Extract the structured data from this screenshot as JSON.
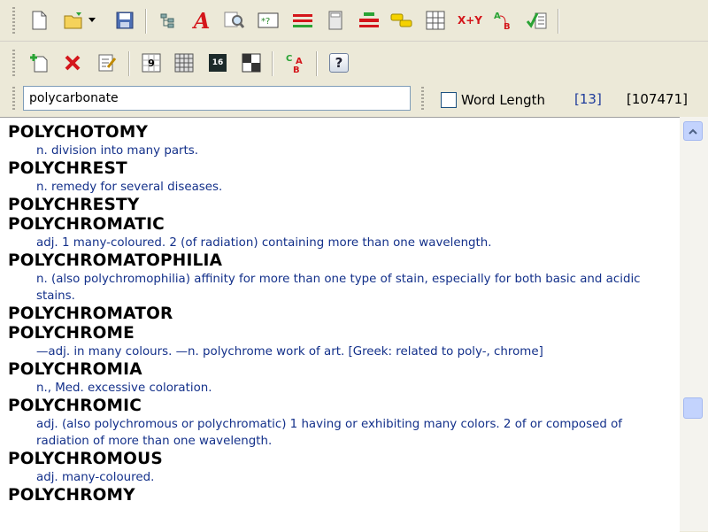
{
  "toolbar_top": {
    "buttons": [
      {
        "name": "new-document-icon"
      },
      {
        "name": "open-folder-icon"
      },
      {
        "name": "save-icon"
      },
      {
        "name": "tree-view-icon"
      },
      {
        "name": "anagram-icon"
      },
      {
        "name": "find-icon"
      },
      {
        "name": "wildcard-icon"
      },
      {
        "name": "rhyme-icon"
      },
      {
        "name": "calculator-icon"
      },
      {
        "name": "word-split-icon"
      },
      {
        "name": "tag-icon"
      },
      {
        "name": "grid-icon"
      },
      {
        "name": "cipher-icon"
      },
      {
        "name": "abc-icon"
      },
      {
        "name": "spell-check-icon"
      }
    ],
    "cipher_text": "X+Y",
    "abc_text_a": "A",
    "abc_text_b": "B"
  },
  "toolbar_bottom": {
    "buttons": [
      {
        "name": "add-word-icon"
      },
      {
        "name": "delete-icon"
      },
      {
        "name": "edit-icon"
      },
      {
        "name": "sudoku-icon"
      },
      {
        "name": "board-icon"
      },
      {
        "name": "number-grid-icon"
      },
      {
        "name": "crossword-icon"
      },
      {
        "name": "letter-swap-icon"
      },
      {
        "name": "help-icon"
      }
    ],
    "sudoku_text": "9",
    "number_text": "16",
    "help_text": "?"
  },
  "search": {
    "value": "polycarbonate",
    "word_length_label": "Word Length",
    "word_length_checked": false,
    "match_count": "[13]",
    "total_count": "[107471]"
  },
  "entries": [
    {
      "word": "POLYCHOTOMY",
      "defs": [
        "n. division into many parts."
      ]
    },
    {
      "word": "POLYCHREST",
      "defs": [
        "n. remedy for several diseases."
      ]
    },
    {
      "word": "POLYCHRESTY",
      "defs": []
    },
    {
      "word": "POLYCHROMATIC",
      "defs": [
        "adj. 1 many-coloured. 2 (of radiation) containing more than one wavelength."
      ]
    },
    {
      "word": "POLYCHROMATOPHILIA",
      "defs": [
        "n. (also polychromophilia) affinity for more than one type of stain, especially for both basic and acidic stains."
      ]
    },
    {
      "word": "POLYCHROMATOR",
      "defs": []
    },
    {
      "word": "POLYCHROME",
      "defs": [
        "—adj. in many colours. —n. polychrome work of art. [Greek: related to poly-, chrome]"
      ]
    },
    {
      "word": "POLYCHROMIA",
      "defs": [
        "n., Med. excessive coloration."
      ]
    },
    {
      "word": "POLYCHROMIC",
      "defs": [
        "adj. (also polychromous or polychromatic) 1 having or exhibiting many colors. 2 of or composed of radiation of more than one wavelength."
      ]
    },
    {
      "word": "POLYCHROMOUS",
      "defs": [
        "adj. many-coloured."
      ]
    },
    {
      "word": "POLYCHROMY",
      "defs": []
    }
  ],
  "colors": {
    "headword": "#000000",
    "definition": "#13308a",
    "count": "#1f3c9b"
  }
}
